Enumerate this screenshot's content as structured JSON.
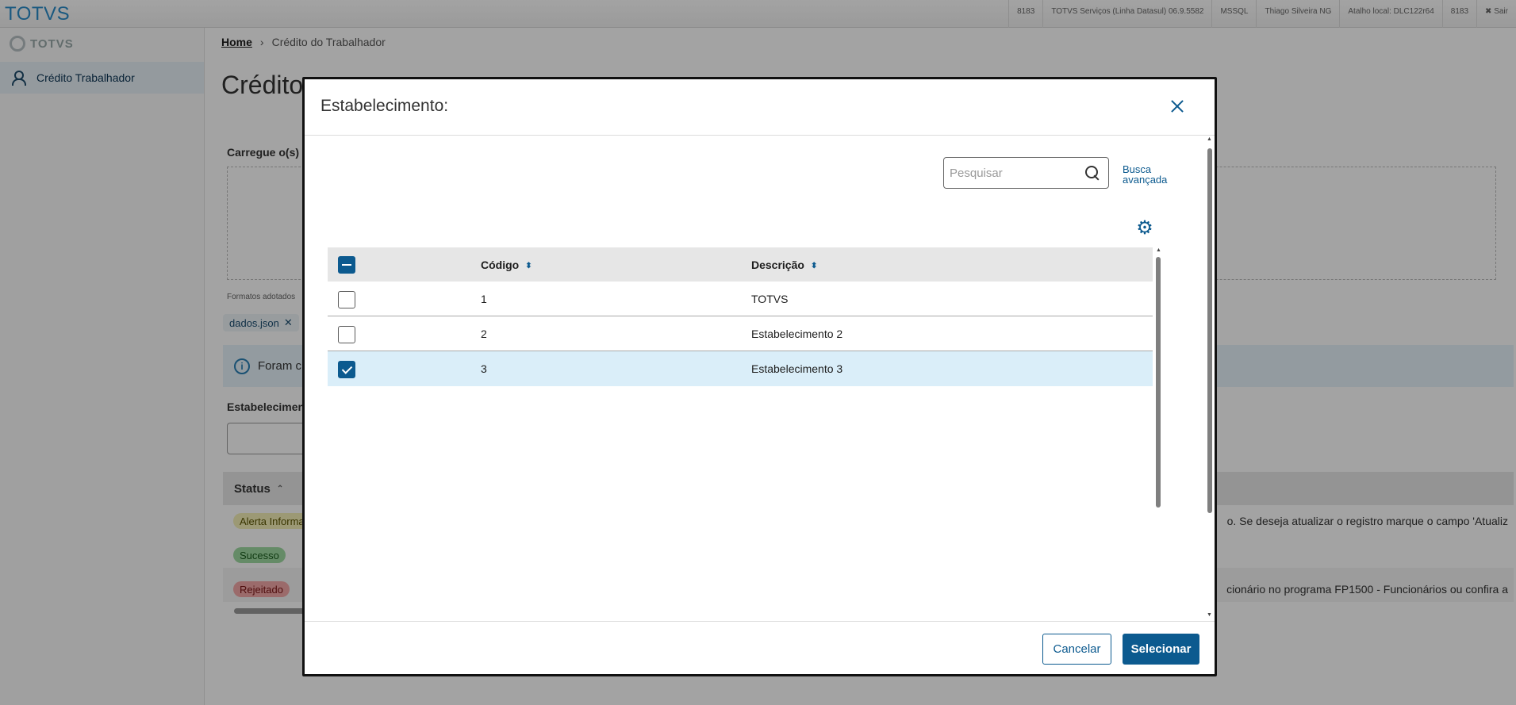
{
  "topbar": {
    "brand": "TOTVS",
    "info": [
      "8183",
      "TOTVS Serviços (Linha Datasul) 06.9.5582",
      "MSSQL",
      "Thiago Silveira NG",
      "Atalho local: DLC122r64",
      "8183"
    ],
    "exit": "✖ Sair"
  },
  "sidebar": {
    "logo": "TOTVS",
    "items": [
      {
        "label": "Crédito Trabalhador"
      }
    ]
  },
  "page": {
    "breadcrumb": {
      "home": "Home",
      "current": "Crédito do Trabalhador"
    },
    "title": "Crédito",
    "upload_label": "Carregue o(s) a",
    "formats": "Formatos adotados",
    "file_chip": "dados.json",
    "alert_text": "Foram c",
    "estab_label": "Estabelecimen",
    "status_header": "Status",
    "badges": {
      "alerta": "Alerta Informa",
      "sucesso": "Sucesso",
      "rejeitado": "Rejeitado"
    },
    "row_texts": {
      "row1": "o. Se deseja atualizar o registro marque o campo 'Atualiz",
      "row3": "cionário no programa FP1500 - Funcionários ou confira a"
    }
  },
  "modal": {
    "title": "Estabelecimento:",
    "search": {
      "placeholder": "Pesquisar",
      "value": ""
    },
    "advanced_search": "Busca avançada",
    "columns": {
      "code": "Código",
      "description": "Descrição"
    },
    "rows": [
      {
        "code": "1",
        "description": "TOTVS",
        "checked": false
      },
      {
        "code": "2",
        "description": "Estabelecimento 2",
        "checked": false
      },
      {
        "code": "3",
        "description": "Estabelecimento 3",
        "checked": true
      }
    ],
    "buttons": {
      "cancel": "Cancelar",
      "select": "Selecionar"
    }
  },
  "colors": {
    "primary": "#0c5a8f",
    "selected_row": "#daeef9",
    "brand": "#2a8bc9"
  }
}
